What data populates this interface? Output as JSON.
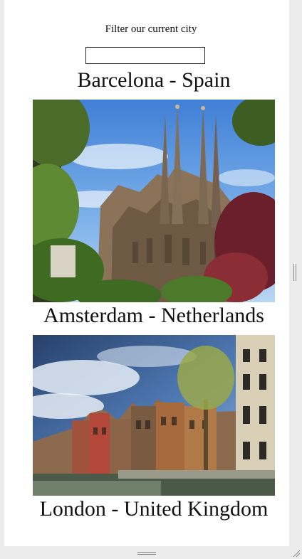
{
  "filter": {
    "label": "Filter our current city",
    "value": "",
    "placeholder": ""
  },
  "cities": [
    {
      "title": "Barcelona - Spain"
    },
    {
      "title": "Amsterdam - Netherlands"
    },
    {
      "title": "London - United Kingdom"
    }
  ],
  "icons": {
    "side_handle": "vertical-resize-grip-icon",
    "bottom_handle": "horizontal-resize-grip-icon",
    "corner": "window-resize-corner-icon"
  }
}
